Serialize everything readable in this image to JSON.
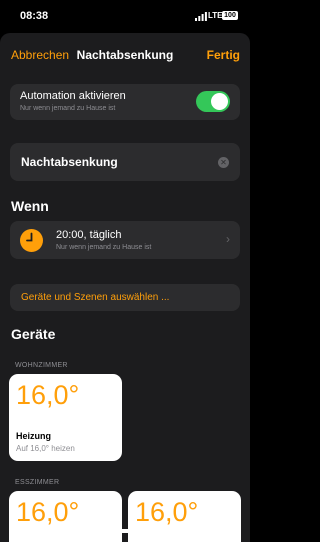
{
  "status_bar": {
    "time": "08:38",
    "network": "LTE",
    "battery": "100"
  },
  "nav": {
    "cancel_label": "Abbrechen",
    "title": "Nachtabsenkung",
    "done_label": "Fertig"
  },
  "automation": {
    "title": "Automation aktivieren",
    "subtitle": "Nur wenn jemand zu Hause ist",
    "enabled": true
  },
  "name_field": {
    "value": "Nachtabsenkung"
  },
  "when": {
    "heading": "Wenn",
    "trigger": {
      "title": "20:00, täglich",
      "subtitle": "Nur wenn jemand zu Hause ist"
    }
  },
  "select_button": {
    "label": "Geräte und Szenen auswählen ..."
  },
  "devices": {
    "heading": "Geräte",
    "rooms": [
      {
        "name": "WOHNZIMMER",
        "tiles": [
          {
            "temp": "16,0°",
            "name": "Heizung",
            "status": "Auf 16,0° heizen"
          }
        ]
      },
      {
        "name": "ESSZIMMER",
        "tiles": [
          {
            "temp": "16,0°"
          },
          {
            "temp": "16,0°"
          }
        ]
      }
    ]
  },
  "colors": {
    "accent": "#ff9f0a",
    "toggle_on": "#34c759",
    "card": "#2c2c2e",
    "sheet": "#1c1c1e"
  }
}
